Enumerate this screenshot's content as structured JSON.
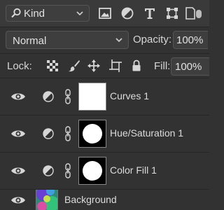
{
  "filter": {
    "kind_label": "Kind",
    "icons": [
      "image-filter-icon",
      "adjustment-filter-icon",
      "type-filter-icon",
      "shape-filter-icon",
      "smart-object-filter-icon"
    ]
  },
  "blend": {
    "mode": "Normal",
    "opacity_label": "Opacity:",
    "opacity_value": "100%"
  },
  "lock": {
    "label": "Lock:",
    "fill_label": "Fill:",
    "fill_value": "100%",
    "icons": [
      "lock-transparent-pixels-icon",
      "lock-image-pixels-icon",
      "lock-position-icon",
      "lock-artboard-icon",
      "lock-all-icon"
    ]
  },
  "layers": [
    {
      "name": "Curves 1",
      "type": "adjustment",
      "mask": "white"
    },
    {
      "name": "Hue/Saturation 1",
      "type": "adjustment",
      "mask": "circle"
    },
    {
      "name": "Color Fill 1",
      "type": "adjustment",
      "mask": "circle"
    },
    {
      "name": "Background",
      "type": "raster"
    }
  ],
  "colors": {
    "panel": "#323232",
    "field": "#3e3e3e",
    "text": "#d6d6d6"
  }
}
